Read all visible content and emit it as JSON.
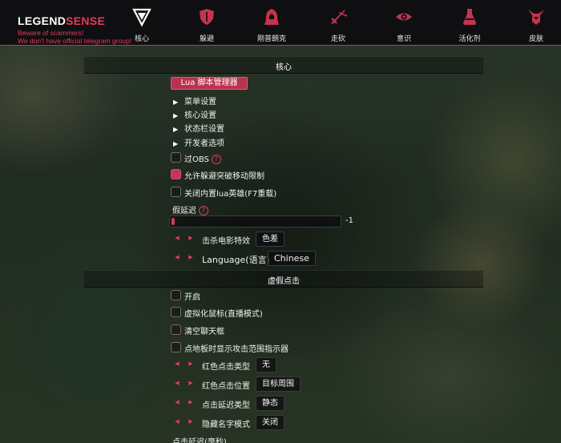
{
  "brand": {
    "title_main": "LEGEND",
    "title_accent": "SENSE",
    "warning_1": "Beware of scammers!",
    "warning_2": "We don't have official telegram group!"
  },
  "tabs": [
    {
      "label": "核心",
      "icon": "shield-v-icon",
      "active": true
    },
    {
      "label": "躲避",
      "icon": "shield-icon"
    },
    {
      "label": "刚普朗克",
      "icon": "hooded-figure-icon"
    },
    {
      "label": "走砍",
      "icon": "sword-icon"
    },
    {
      "label": "意识",
      "icon": "eye-icon"
    },
    {
      "label": "活化剂",
      "icon": "potion-icon"
    },
    {
      "label": "皮肤",
      "icon": "horned-helmet-icon"
    }
  ],
  "colors": {
    "accent": "#e23b5c",
    "header_bg": "#0f0f12",
    "button_bg": "#b8324f"
  },
  "sections": {
    "core_title": "核心",
    "fake_click_title": "虚假点击"
  },
  "lua_button": "Lua 脚本管理器",
  "tree": [
    "菜单设置",
    "核心设置",
    "状态栏设置",
    "开发者选项"
  ],
  "core_checks": [
    {
      "label": "过OBS",
      "checked": false,
      "help": true
    },
    {
      "label": "允许躲避突破移动限制",
      "checked": true,
      "help": false
    },
    {
      "label": "关闭内置lua英雄(F7重载)",
      "checked": false,
      "help": false
    }
  ],
  "fake_latency": {
    "label": "假延迟",
    "value": "-1",
    "fill_fraction": 0.02
  },
  "core_combos": [
    {
      "label": "击杀电影特效",
      "value": "色差"
    },
    {
      "label": "Language(语言)",
      "value": "Chinese"
    }
  ],
  "click_checks": [
    {
      "label": "开启",
      "checked": false
    },
    {
      "label": "虚拟化鼠标(直播模式)",
      "checked": false
    },
    {
      "label": "清空聊天框",
      "checked": false
    },
    {
      "label": "点地板时显示攻击范围指示器",
      "checked": false
    }
  ],
  "click_combos": [
    {
      "label": "红色点击类型",
      "value": "无"
    },
    {
      "label": "红色点击位置",
      "value": "目标周围"
    },
    {
      "label": "点击延迟类型",
      "value": "静态"
    },
    {
      "label": "隐藏名字模式",
      "value": "关闭"
    }
  ],
  "click_delay_label": "点击延迟(毫秒)"
}
